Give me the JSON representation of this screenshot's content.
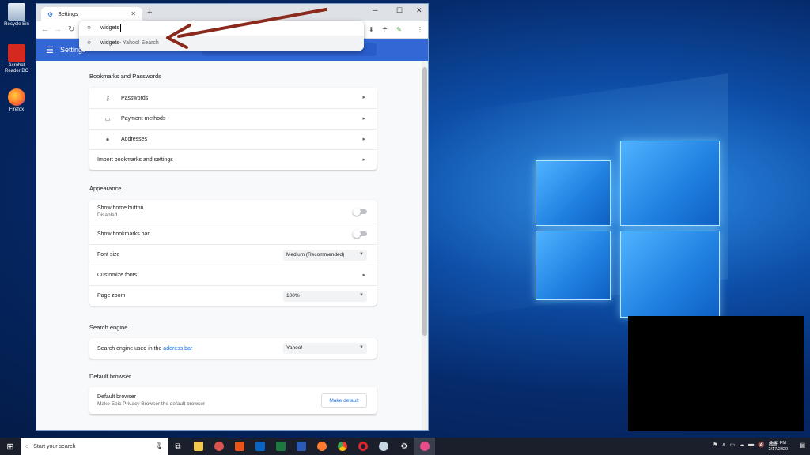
{
  "desktop": {
    "icons": [
      {
        "label": "Recycle Bin",
        "icon": "recycle-bin-icon"
      },
      {
        "label": "Acrobat Reader DC",
        "icon": "acrobat-icon"
      },
      {
        "label": "Firefox",
        "icon": "firefox-icon"
      }
    ]
  },
  "browser": {
    "tab_title": "Settings",
    "new_tab": "+",
    "window_controls": {
      "minimize": "─",
      "maximize": "☐",
      "close": "✕"
    },
    "omnibox": {
      "query": "widgets",
      "suggestion_main": "widgets",
      "suggestion_suffix": " - Yahoo! Search"
    }
  },
  "settings": {
    "header_title": "Settings",
    "sections": {
      "bookmarks": {
        "title": "Bookmarks and Passwords",
        "passwords": "Passwords",
        "payment": "Payment methods",
        "addresses": "Addresses",
        "import": "Import bookmarks and settings"
      },
      "appearance": {
        "title": "Appearance",
        "home_button": "Show home button",
        "home_button_state": "Disabled",
        "bookmarks_bar": "Show bookmarks bar",
        "font_size": "Font size",
        "font_size_value": "Medium (Recommended)",
        "customize_fonts": "Customize fonts",
        "page_zoom": "Page zoom",
        "page_zoom_value": "100%"
      },
      "search_engine": {
        "title": "Search engine",
        "label_prefix": "Search engine used in the ",
        "label_link": "address bar",
        "value": "Yahoo!"
      },
      "default_browser": {
        "title": "Default browser",
        "label": "Default browser",
        "sub": "Make Epic Privacy Browser the default browser",
        "button": "Make default"
      }
    }
  },
  "taskbar": {
    "search_placeholder": "Start your search",
    "time": "3:33 PM",
    "date": "2/17/2020"
  },
  "colors": {
    "settings_header": "#3367d6",
    "accent": "#1a73e8",
    "annotation_arrow": "#8b2a1c"
  }
}
